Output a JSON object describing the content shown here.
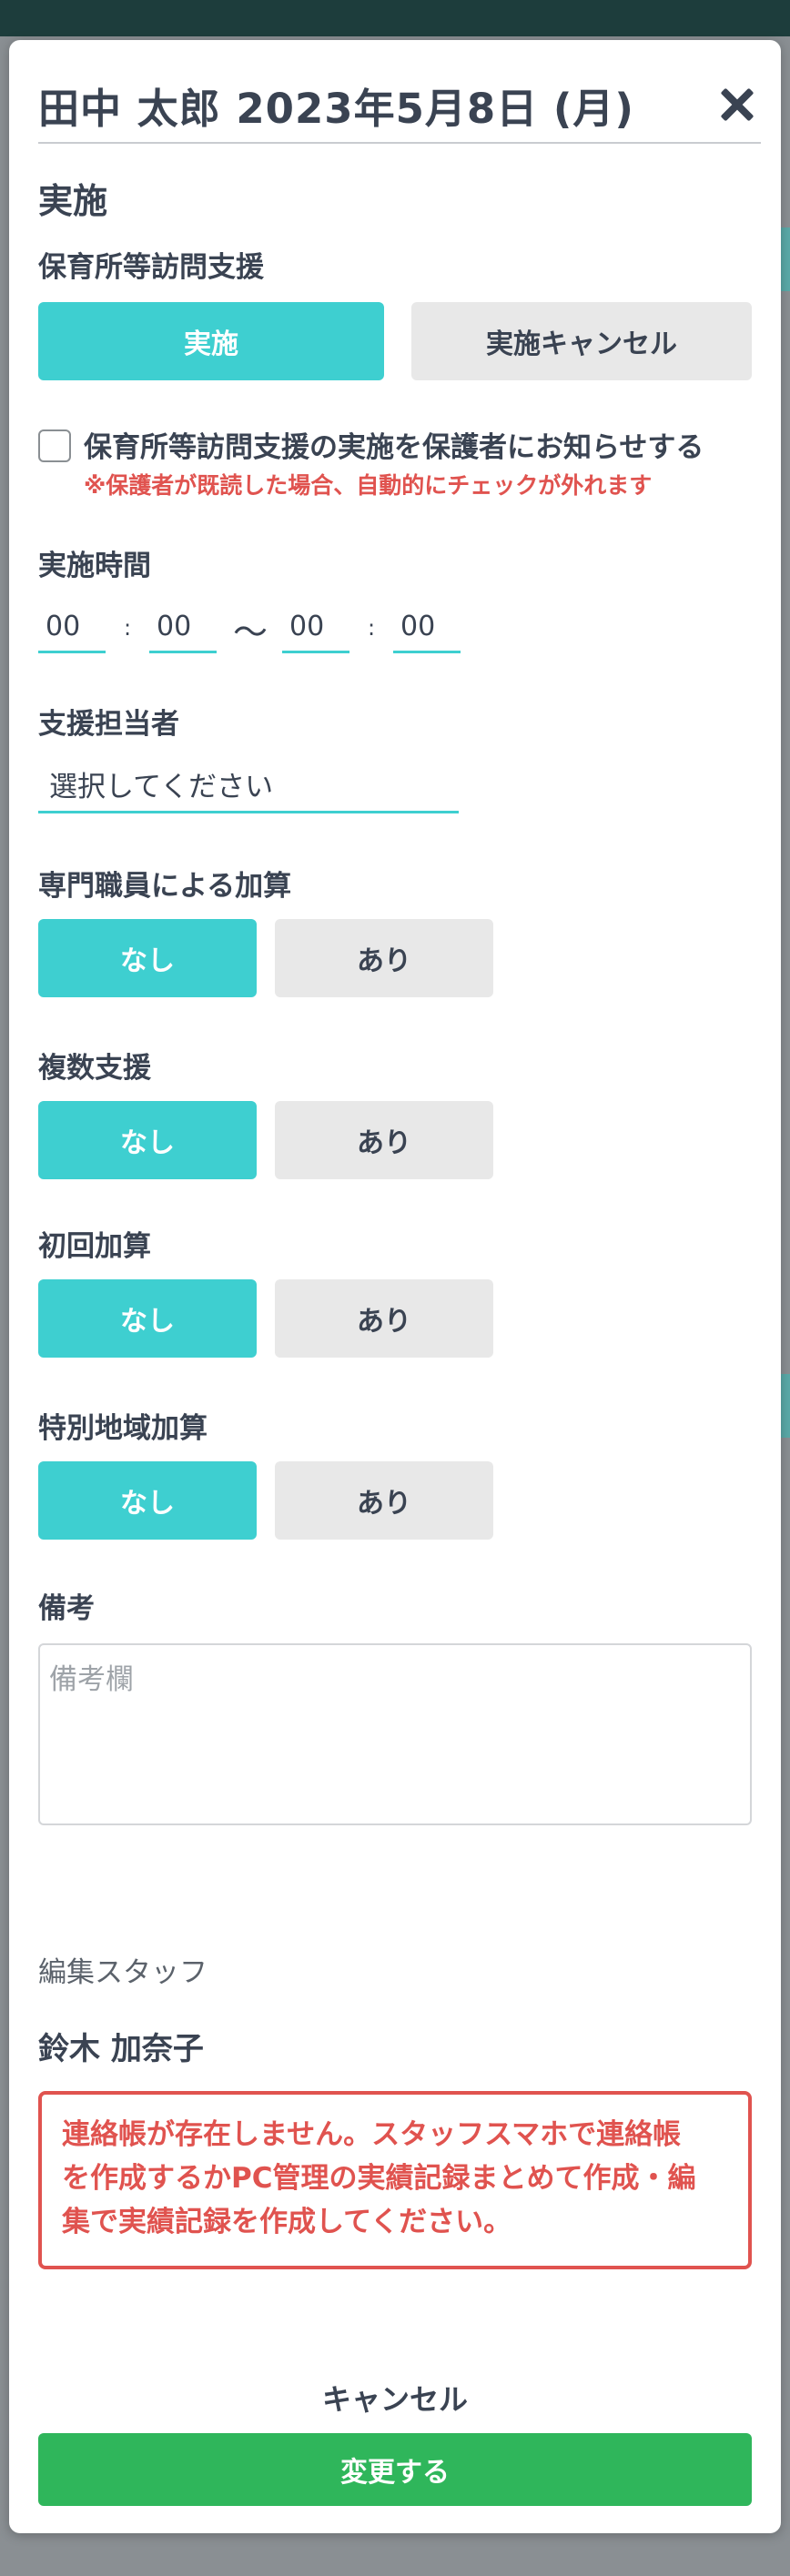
{
  "modal": {
    "title": "田中 太郎 2023年5月8日 (月)",
    "section_heading": "実施"
  },
  "visit_support": {
    "label": "保育所等訪問支援",
    "implement_label": "実施",
    "cancel_label": "実施キャンセル",
    "selected": "実施"
  },
  "notify": {
    "label": "保育所等訪問支援の実施を保護者にお知らせする",
    "note": "※保護者が既読した場合、自動的にチェックが外れます",
    "checked": false
  },
  "time": {
    "label": "実施時間",
    "start_hour": "00",
    "start_minute": "00",
    "end_hour": "00",
    "end_minute": "00",
    "colon": ":",
    "tilde": "〜"
  },
  "staff_select": {
    "label": "支援担当者",
    "value": "選択してください"
  },
  "options_none": "なし",
  "options_yes": "あり",
  "toggles": [
    {
      "label": "専門職員による加算",
      "selected": "なし"
    },
    {
      "label": "複数支援",
      "selected": "なし"
    },
    {
      "label": "初回加算",
      "selected": "なし"
    },
    {
      "label": "特別地域加算",
      "selected": "なし"
    }
  ],
  "remarks": {
    "label": "備考",
    "placeholder": "備考欄"
  },
  "editor": {
    "label": "編集スタッフ",
    "name": "鈴木 加奈子"
  },
  "alert": {
    "line1": "連絡帳が存在しません。スタッフスマホで連絡帳",
    "line2": "を作成するかPC管理の実績記録まとめて作成・編",
    "line3": "集で実績記録を作成してください。"
  },
  "footer": {
    "cancel_label": "キャンセル",
    "submit_label": "変更する"
  },
  "colors": {
    "accent": "#3ecfd0",
    "submit": "#2fb65b",
    "alert": "#e0534f",
    "text": "#3a4352"
  }
}
